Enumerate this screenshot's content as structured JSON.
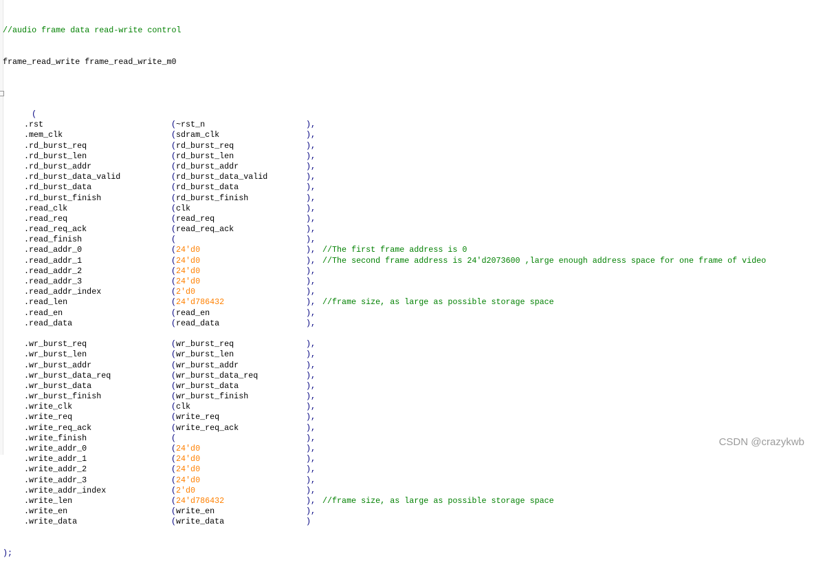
{
  "header_comment": "//audio frame data read-write control",
  "instance_line": "frame_read_write frame_read_write_m0",
  "open_paren": "(",
  "close_line": ");",
  "colors": {
    "comment": "#008000",
    "number": "#ff8000",
    "paren": "#000080",
    "text": "#000000"
  },
  "ports": [
    {
      "port": ".rst",
      "sig": "~rst_n",
      "sig_type": "ident",
      "end": "),",
      "comment": ""
    },
    {
      "port": ".mem_clk",
      "sig": "sdram_clk",
      "sig_type": "ident",
      "end": "),",
      "comment": ""
    },
    {
      "port": ".rd_burst_req",
      "sig": "rd_burst_req",
      "sig_type": "ident",
      "end": "),",
      "comment": ""
    },
    {
      "port": ".rd_burst_len",
      "sig": "rd_burst_len",
      "sig_type": "ident",
      "end": "),",
      "comment": ""
    },
    {
      "port": ".rd_burst_addr",
      "sig": "rd_burst_addr",
      "sig_type": "ident",
      "end": "),",
      "comment": ""
    },
    {
      "port": ".rd_burst_data_valid",
      "sig": "rd_burst_data_valid",
      "sig_type": "ident",
      "end": "),",
      "comment": ""
    },
    {
      "port": ".rd_burst_data",
      "sig": "rd_burst_data",
      "sig_type": "ident",
      "end": "),",
      "comment": ""
    },
    {
      "port": ".rd_burst_finish",
      "sig": "rd_burst_finish",
      "sig_type": "ident",
      "end": "),",
      "comment": ""
    },
    {
      "port": ".read_clk",
      "sig": "clk",
      "sig_type": "ident",
      "end": "),",
      "comment": ""
    },
    {
      "port": ".read_req",
      "sig": "read_req",
      "sig_type": "ident",
      "end": "),",
      "comment": ""
    },
    {
      "port": ".read_req_ack",
      "sig": "read_req_ack",
      "sig_type": "ident",
      "end": "),",
      "comment": ""
    },
    {
      "port": ".read_finish",
      "sig": "",
      "sig_type": "ident",
      "end": "),",
      "comment": ""
    },
    {
      "port": ".read_addr_0",
      "sig": "24'd0",
      "sig_type": "num",
      "end": "),",
      "comment": "//The first frame address is 0"
    },
    {
      "port": ".read_addr_1",
      "sig": "24'd0",
      "sig_type": "num",
      "end": "),",
      "comment": "//The second frame address is 24'd2073600 ,large enough address space for one frame of video"
    },
    {
      "port": ".read_addr_2",
      "sig": "24'd0",
      "sig_type": "num",
      "end": "),",
      "comment": ""
    },
    {
      "port": ".read_addr_3",
      "sig": "24'd0",
      "sig_type": "num",
      "end": "),",
      "comment": ""
    },
    {
      "port": ".read_addr_index",
      "sig": "2'd0",
      "sig_type": "num",
      "end": "),",
      "comment": ""
    },
    {
      "port": ".read_len",
      "sig": "24'd786432",
      "sig_type": "num",
      "end": "),",
      "comment": "//frame size, as large as possible storage space"
    },
    {
      "port": ".read_en",
      "sig": "read_en",
      "sig_type": "ident",
      "end": "),",
      "comment": ""
    },
    {
      "port": ".read_data",
      "sig": "read_data",
      "sig_type": "ident",
      "end": "),",
      "comment": ""
    },
    {
      "blank": true
    },
    {
      "port": ".wr_burst_req",
      "sig": "wr_burst_req",
      "sig_type": "ident",
      "end": "),",
      "comment": ""
    },
    {
      "port": ".wr_burst_len",
      "sig": "wr_burst_len",
      "sig_type": "ident",
      "end": "),",
      "comment": ""
    },
    {
      "port": ".wr_burst_addr",
      "sig": "wr_burst_addr",
      "sig_type": "ident",
      "end": "),",
      "comment": ""
    },
    {
      "port": ".wr_burst_data_req",
      "sig": "wr_burst_data_req",
      "sig_type": "ident",
      "end": "),",
      "comment": ""
    },
    {
      "port": ".wr_burst_data",
      "sig": "wr_burst_data",
      "sig_type": "ident",
      "end": "),",
      "comment": ""
    },
    {
      "port": ".wr_burst_finish",
      "sig": "wr_burst_finish",
      "sig_type": "ident",
      "end": "),",
      "comment": ""
    },
    {
      "port": ".write_clk",
      "sig": "clk",
      "sig_type": "ident",
      "end": "),",
      "comment": ""
    },
    {
      "port": ".write_req",
      "sig": "write_req",
      "sig_type": "ident",
      "end": "),",
      "comment": ""
    },
    {
      "port": ".write_req_ack",
      "sig": "write_req_ack",
      "sig_type": "ident",
      "end": "),",
      "comment": ""
    },
    {
      "port": ".write_finish",
      "sig": "",
      "sig_type": "ident",
      "end": "),",
      "comment": ""
    },
    {
      "port": ".write_addr_0",
      "sig": "24'd0",
      "sig_type": "num",
      "end": "),",
      "comment": ""
    },
    {
      "port": ".write_addr_1",
      "sig": "24'd0",
      "sig_type": "num",
      "end": "),",
      "comment": ""
    },
    {
      "port": ".write_addr_2",
      "sig": "24'd0",
      "sig_type": "num",
      "end": "),",
      "comment": ""
    },
    {
      "port": ".write_addr_3",
      "sig": "24'd0",
      "sig_type": "num",
      "end": "),",
      "comment": ""
    },
    {
      "port": ".write_addr_index",
      "sig": "2'd0",
      "sig_type": "num",
      "end": "),",
      "comment": ""
    },
    {
      "port": ".write_len",
      "sig": "24'd786432",
      "sig_type": "num",
      "end": "),",
      "comment": "//frame size, as large as possible storage space"
    },
    {
      "port": ".write_en",
      "sig": "write_en",
      "sig_type": "ident",
      "end": "),",
      "comment": ""
    },
    {
      "port": ".write_data",
      "sig": "write_data",
      "sig_type": "ident",
      "end": ")",
      "comment": ""
    }
  ],
  "watermark": "CSDN @crazykwb"
}
